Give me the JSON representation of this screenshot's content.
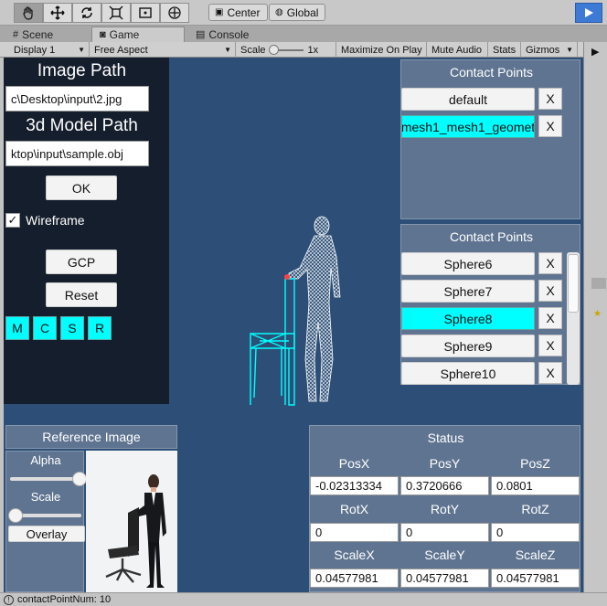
{
  "toolbar": {
    "tool_icons": [
      "hand-icon",
      "move-icon",
      "rotate-icon",
      "scale-icon",
      "rect-icon",
      "transform-icon"
    ],
    "pivot_label": "Center",
    "space_label": "Global"
  },
  "tabs": [
    {
      "label": "Scene"
    },
    {
      "label": "Game"
    },
    {
      "label": "Console"
    }
  ],
  "game_bar": {
    "display": "Display 1",
    "aspect": "Free Aspect",
    "scale_label": "Scale",
    "scale_value": "1x",
    "maximize": "Maximize On Play",
    "mute": "Mute Audio",
    "stats": "Stats",
    "gizmos": "Gizmos"
  },
  "left_panel": {
    "image_path_label": "Image Path",
    "image_path_value": "c\\Desktop\\input\\2.jpg",
    "model_path_label": "3d Model Path",
    "model_path_value": "ktop\\input\\sample.obj",
    "ok_label": "OK",
    "wireframe_label": "Wireframe",
    "wireframe_checked": true,
    "gcp_label": "GCP",
    "reset_label": "Reset",
    "mode_buttons": [
      "M",
      "C",
      "S",
      "R"
    ]
  },
  "contact_points_top": {
    "title": "Contact Points",
    "items": [
      {
        "label": "default",
        "selected": false
      },
      {
        "label": "mesh1_mesh1_geomet",
        "selected": true
      }
    ],
    "x_label": "X"
  },
  "contact_points_list": {
    "title": "Contact Points",
    "items": [
      {
        "label": "Sphere6",
        "selected": false
      },
      {
        "label": "Sphere7",
        "selected": false
      },
      {
        "label": "Sphere8",
        "selected": true
      },
      {
        "label": "Sphere9",
        "selected": false
      },
      {
        "label": "Sphere10",
        "selected": false
      }
    ],
    "x_label": "X"
  },
  "reference": {
    "title": "Reference Image",
    "alpha_label": "Alpha",
    "alpha_value": 1.0,
    "scale_label": "Scale",
    "scale_value": 0.0,
    "overlay_label": "Overlay"
  },
  "status": {
    "title": "Status",
    "pos_labels": [
      "PosX",
      "PosY",
      "PosZ"
    ],
    "pos_values": [
      "-0.02313334",
      "0.3720666",
      "0.0801"
    ],
    "rot_labels": [
      "RotX",
      "RotY",
      "RotZ"
    ],
    "rot_values": [
      "0",
      "0",
      "0"
    ],
    "scale_labels": [
      "ScaleX",
      "ScaleY",
      "ScaleZ"
    ],
    "scale_values": [
      "0.04577981",
      "0.04577981",
      "0.04577981"
    ]
  },
  "status_bar": {
    "message": "contactPointNum: 10"
  },
  "colors": {
    "game_bg": "#2d4f77",
    "selected": "#00ffff",
    "panel": "#5f7491",
    "left_panel": "#151e2c"
  }
}
